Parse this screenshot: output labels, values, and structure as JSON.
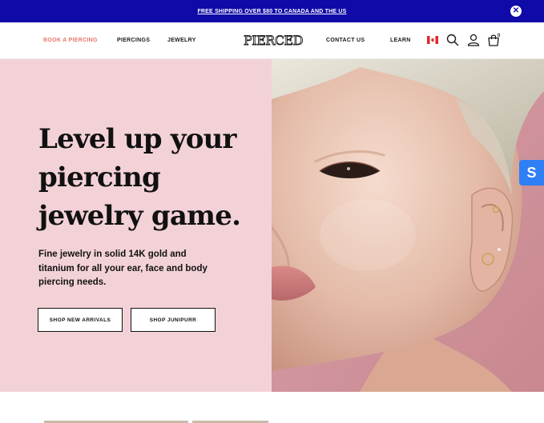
{
  "promo": {
    "text": "FREE SHIPPING OVER $80 TO CANADA AND THE US",
    "close_icon": "close-icon"
  },
  "nav": {
    "links": [
      {
        "label": "BOOK A PIERCING",
        "accent": true
      },
      {
        "label": "PIERCINGS"
      },
      {
        "label": "JEWELRY"
      },
      {
        "label": "CONTACT US"
      },
      {
        "label": "LEARN"
      }
    ],
    "logo": "PIERCED",
    "flag_icon": "canada-flag-icon",
    "search_icon": "search-icon",
    "account_icon": "user-icon",
    "cart_icon": "shopping-bag-icon",
    "cart_count": "0"
  },
  "hero": {
    "title": "Level up your piercing jewelry game.",
    "subtitle": "Fine jewelry in solid 14K gold and titanium for all your ear, face and body piercing needs.",
    "buttons": [
      {
        "label": "SHOP NEW ARRIVALS"
      },
      {
        "label": "SHOP JUNIPURR"
      }
    ],
    "left_bg": "#f3d2d7"
  },
  "chat": {
    "label": "S",
    "color": "#2f7ff6"
  },
  "colors": {
    "promo_bg": "#0f0aa8",
    "accent": "#e8766b"
  }
}
